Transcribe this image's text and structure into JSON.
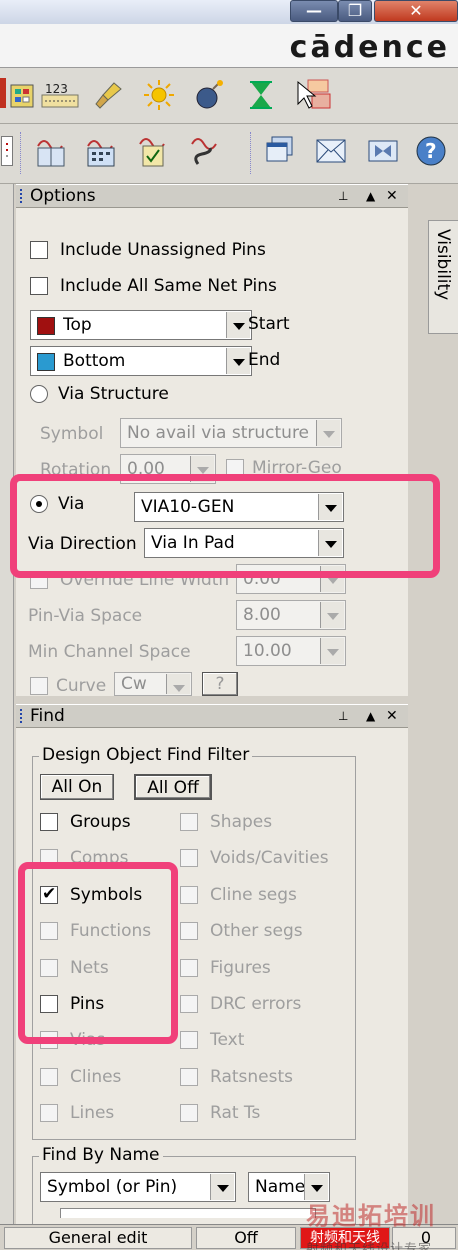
{
  "window": {
    "minimize_glyph": "—",
    "maximize_glyph": "❐",
    "close_glyph": "✕"
  },
  "brand": {
    "logo": "cādence"
  },
  "toolbar1": {
    "icons": [
      "calc-grid-icon",
      "123-counter-icon",
      "brush-icon",
      "sun-icon",
      "bomb-icon",
      "hourglass-icon",
      "select-pointer-icon"
    ],
    "label_123": "123"
  },
  "toolbar2": {
    "icons": [
      "report-icon",
      "book-report-icon",
      "calendar-report-icon",
      "clipboard-report-icon",
      "route-report-icon",
      "copy-windows-icon",
      "envelope-icon",
      "bowtie-icon",
      "help-icon"
    ],
    "help_glyph": "?"
  },
  "visibility_tab": {
    "label": "Visibility"
  },
  "options": {
    "title": "Options",
    "pin_glyph": "📌",
    "up_glyph": "▲",
    "close_glyph": "✕",
    "include_unassigned": "Include Unassigned Pins",
    "include_same_net": "Include All Same Net Pins",
    "start_layer": "Top",
    "start_label": "Start",
    "start_color": "#a01010",
    "end_layer": "Bottom",
    "end_label": "End",
    "end_color": "#2a9ad0",
    "via_structure": "Via Structure",
    "symbol_label": "Symbol",
    "symbol_value": "No avail via structure",
    "rotation_label": "Rotation",
    "rotation_value": "0.00",
    "mirror_geo": "Mirror-Geo",
    "via_label": "Via",
    "via_value": "VIA10-GEN",
    "via_direction_label": "Via Direction",
    "via_direction_value": "Via In Pad",
    "override_line_width": "Override Line Width",
    "override_value": "0.00",
    "pin_via_space_label": "Pin-Via Space",
    "pin_via_space_value": "8.00",
    "min_channel_label": "Min Channel Space",
    "min_channel_value": "10.00",
    "curve_label": "Curve",
    "curve_value": "Cw",
    "curve_btn": "?"
  },
  "find": {
    "title": "Find",
    "group_title": "Design Object Find Filter",
    "all_on": "All On",
    "all_off": "All Off",
    "left_items": [
      {
        "label": "Groups",
        "checked": false,
        "enabled": true
      },
      {
        "label": "Comps",
        "checked": false,
        "enabled": false
      },
      {
        "label": "Symbols",
        "checked": true,
        "enabled": true
      },
      {
        "label": "Functions",
        "checked": false,
        "enabled": false
      },
      {
        "label": "Nets",
        "checked": false,
        "enabled": false
      },
      {
        "label": "Pins",
        "checked": false,
        "enabled": true
      },
      {
        "label": "Vias",
        "checked": false,
        "enabled": false
      },
      {
        "label": "Clines",
        "checked": false,
        "enabled": false
      },
      {
        "label": "Lines",
        "checked": false,
        "enabled": false
      }
    ],
    "right_items": [
      {
        "label": "Shapes",
        "enabled": false
      },
      {
        "label": "Voids/Cavities",
        "enabled": false
      },
      {
        "label": "Cline segs",
        "enabled": false
      },
      {
        "label": "Other segs",
        "enabled": false
      },
      {
        "label": "Figures",
        "enabled": false
      },
      {
        "label": "DRC errors",
        "enabled": false
      },
      {
        "label": "Text",
        "enabled": false
      },
      {
        "label": "Ratsnests",
        "enabled": false
      },
      {
        "label": "Rat Ts",
        "enabled": false
      }
    ],
    "by_name_title": "Find By Name",
    "by_name_type": "Symbol (or Pin)",
    "by_name_mode": "Name"
  },
  "status": {
    "mode": "General edit",
    "state": "Off",
    "red_cell": "射频和天线",
    "right_value": "0"
  },
  "watermark": {
    "main": "易迪拓培训",
    "sub": "射频和天线设计专家"
  },
  "highlight_color": "#f0407a"
}
